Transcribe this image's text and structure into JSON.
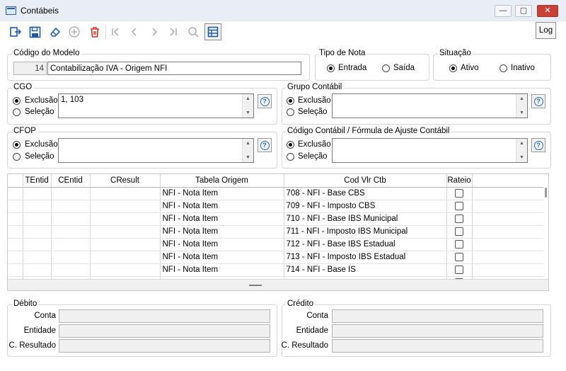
{
  "window": {
    "title": "Contábeis",
    "minimize": "—",
    "maximize": "▢",
    "close": "✕"
  },
  "toolbar": {
    "buttons": [
      "exit",
      "save",
      "erase",
      "add",
      "delete",
      "first",
      "previous",
      "next",
      "last",
      "search",
      "grid-view"
    ],
    "log_label": "Log"
  },
  "modelo": {
    "label": "Código do Modelo",
    "code": "14",
    "description": "Contabilização IVA - Origem NFI"
  },
  "tipo_nota": {
    "label": "Tipo de Nota",
    "options": [
      "Entrada",
      "Saída"
    ],
    "selected": "Entrada"
  },
  "situacao": {
    "label": "Situação",
    "options": [
      "Ativo",
      "Inativo"
    ],
    "selected": "Ativo"
  },
  "cgo": {
    "label": "CGO",
    "options": [
      "Exclusão",
      "Seleção"
    ],
    "selected": "Exclusão",
    "value": "1, 103"
  },
  "grupo_contabil": {
    "label": "Grupo Contábil",
    "options": [
      "Exclusão",
      "Seleção"
    ],
    "selected": "Exclusão",
    "value": ""
  },
  "cfop": {
    "label": "CFOP",
    "options": [
      "Exclusão",
      "Seleção"
    ],
    "selected": "Exclusão",
    "value": ""
  },
  "codigo_contabil": {
    "label": "Código Contábil / Fórmula de Ajuste Contábil",
    "options": [
      "Exclusão",
      "Seleção"
    ],
    "selected": "Exclusão",
    "value": ""
  },
  "grid": {
    "columns": [
      "",
      "TEntid",
      "CEntid",
      "CResult",
      "Tabela Origem",
      "Cod Vlr Ctb",
      "Rateio"
    ],
    "rows": [
      {
        "tentid": "",
        "centid": "",
        "cresult": "",
        "tabela": "NFI - Nota Item",
        "cod": "708 - NFI - Base CBS",
        "rateio": false
      },
      {
        "tentid": "",
        "centid": "",
        "cresult": "",
        "tabela": "NFI - Nota Item",
        "cod": "709 - NFI - Imposto CBS",
        "rateio": false
      },
      {
        "tentid": "",
        "centid": "",
        "cresult": "",
        "tabela": "NFI - Nota Item",
        "cod": "710 - NFI - Base IBS Municipal",
        "rateio": false
      },
      {
        "tentid": "",
        "centid": "",
        "cresult": "",
        "tabela": "NFI - Nota Item",
        "cod": "711 - NFI - Imposto IBS Municipal",
        "rateio": false
      },
      {
        "tentid": "",
        "centid": "",
        "cresult": "",
        "tabela": "NFI - Nota Item",
        "cod": "712 - NFI - Base IBS Estadual",
        "rateio": false
      },
      {
        "tentid": "",
        "centid": "",
        "cresult": "",
        "tabela": "NFI - Nota Item",
        "cod": "713 - NFI - Imposto IBS Estadual",
        "rateio": false
      },
      {
        "tentid": "",
        "centid": "",
        "cresult": "",
        "tabela": "NFI - Nota Item",
        "cod": "714 - NFI - Base IS",
        "rateio": false
      },
      {
        "tentid": "",
        "centid": "",
        "cresult": "",
        "tabela": "",
        "cod": "",
        "rateio": false
      }
    ]
  },
  "debito": {
    "label": "Débito",
    "conta_label": "Conta",
    "entidade_label": "Entidade",
    "resultado_label": "C. Resultado",
    "conta": "",
    "entidade": "",
    "resultado": ""
  },
  "credito": {
    "label": "Crédito",
    "conta_label": "Conta",
    "entidade_label": "Entidade",
    "resultado_label": "C. Resultado",
    "conta": "",
    "entidade": "",
    "resultado": ""
  },
  "colors": {
    "titlebar": "#e9eef6",
    "close": "#c94237",
    "accent_blue": "#1e5aa8",
    "delete_red": "#d9362b"
  }
}
